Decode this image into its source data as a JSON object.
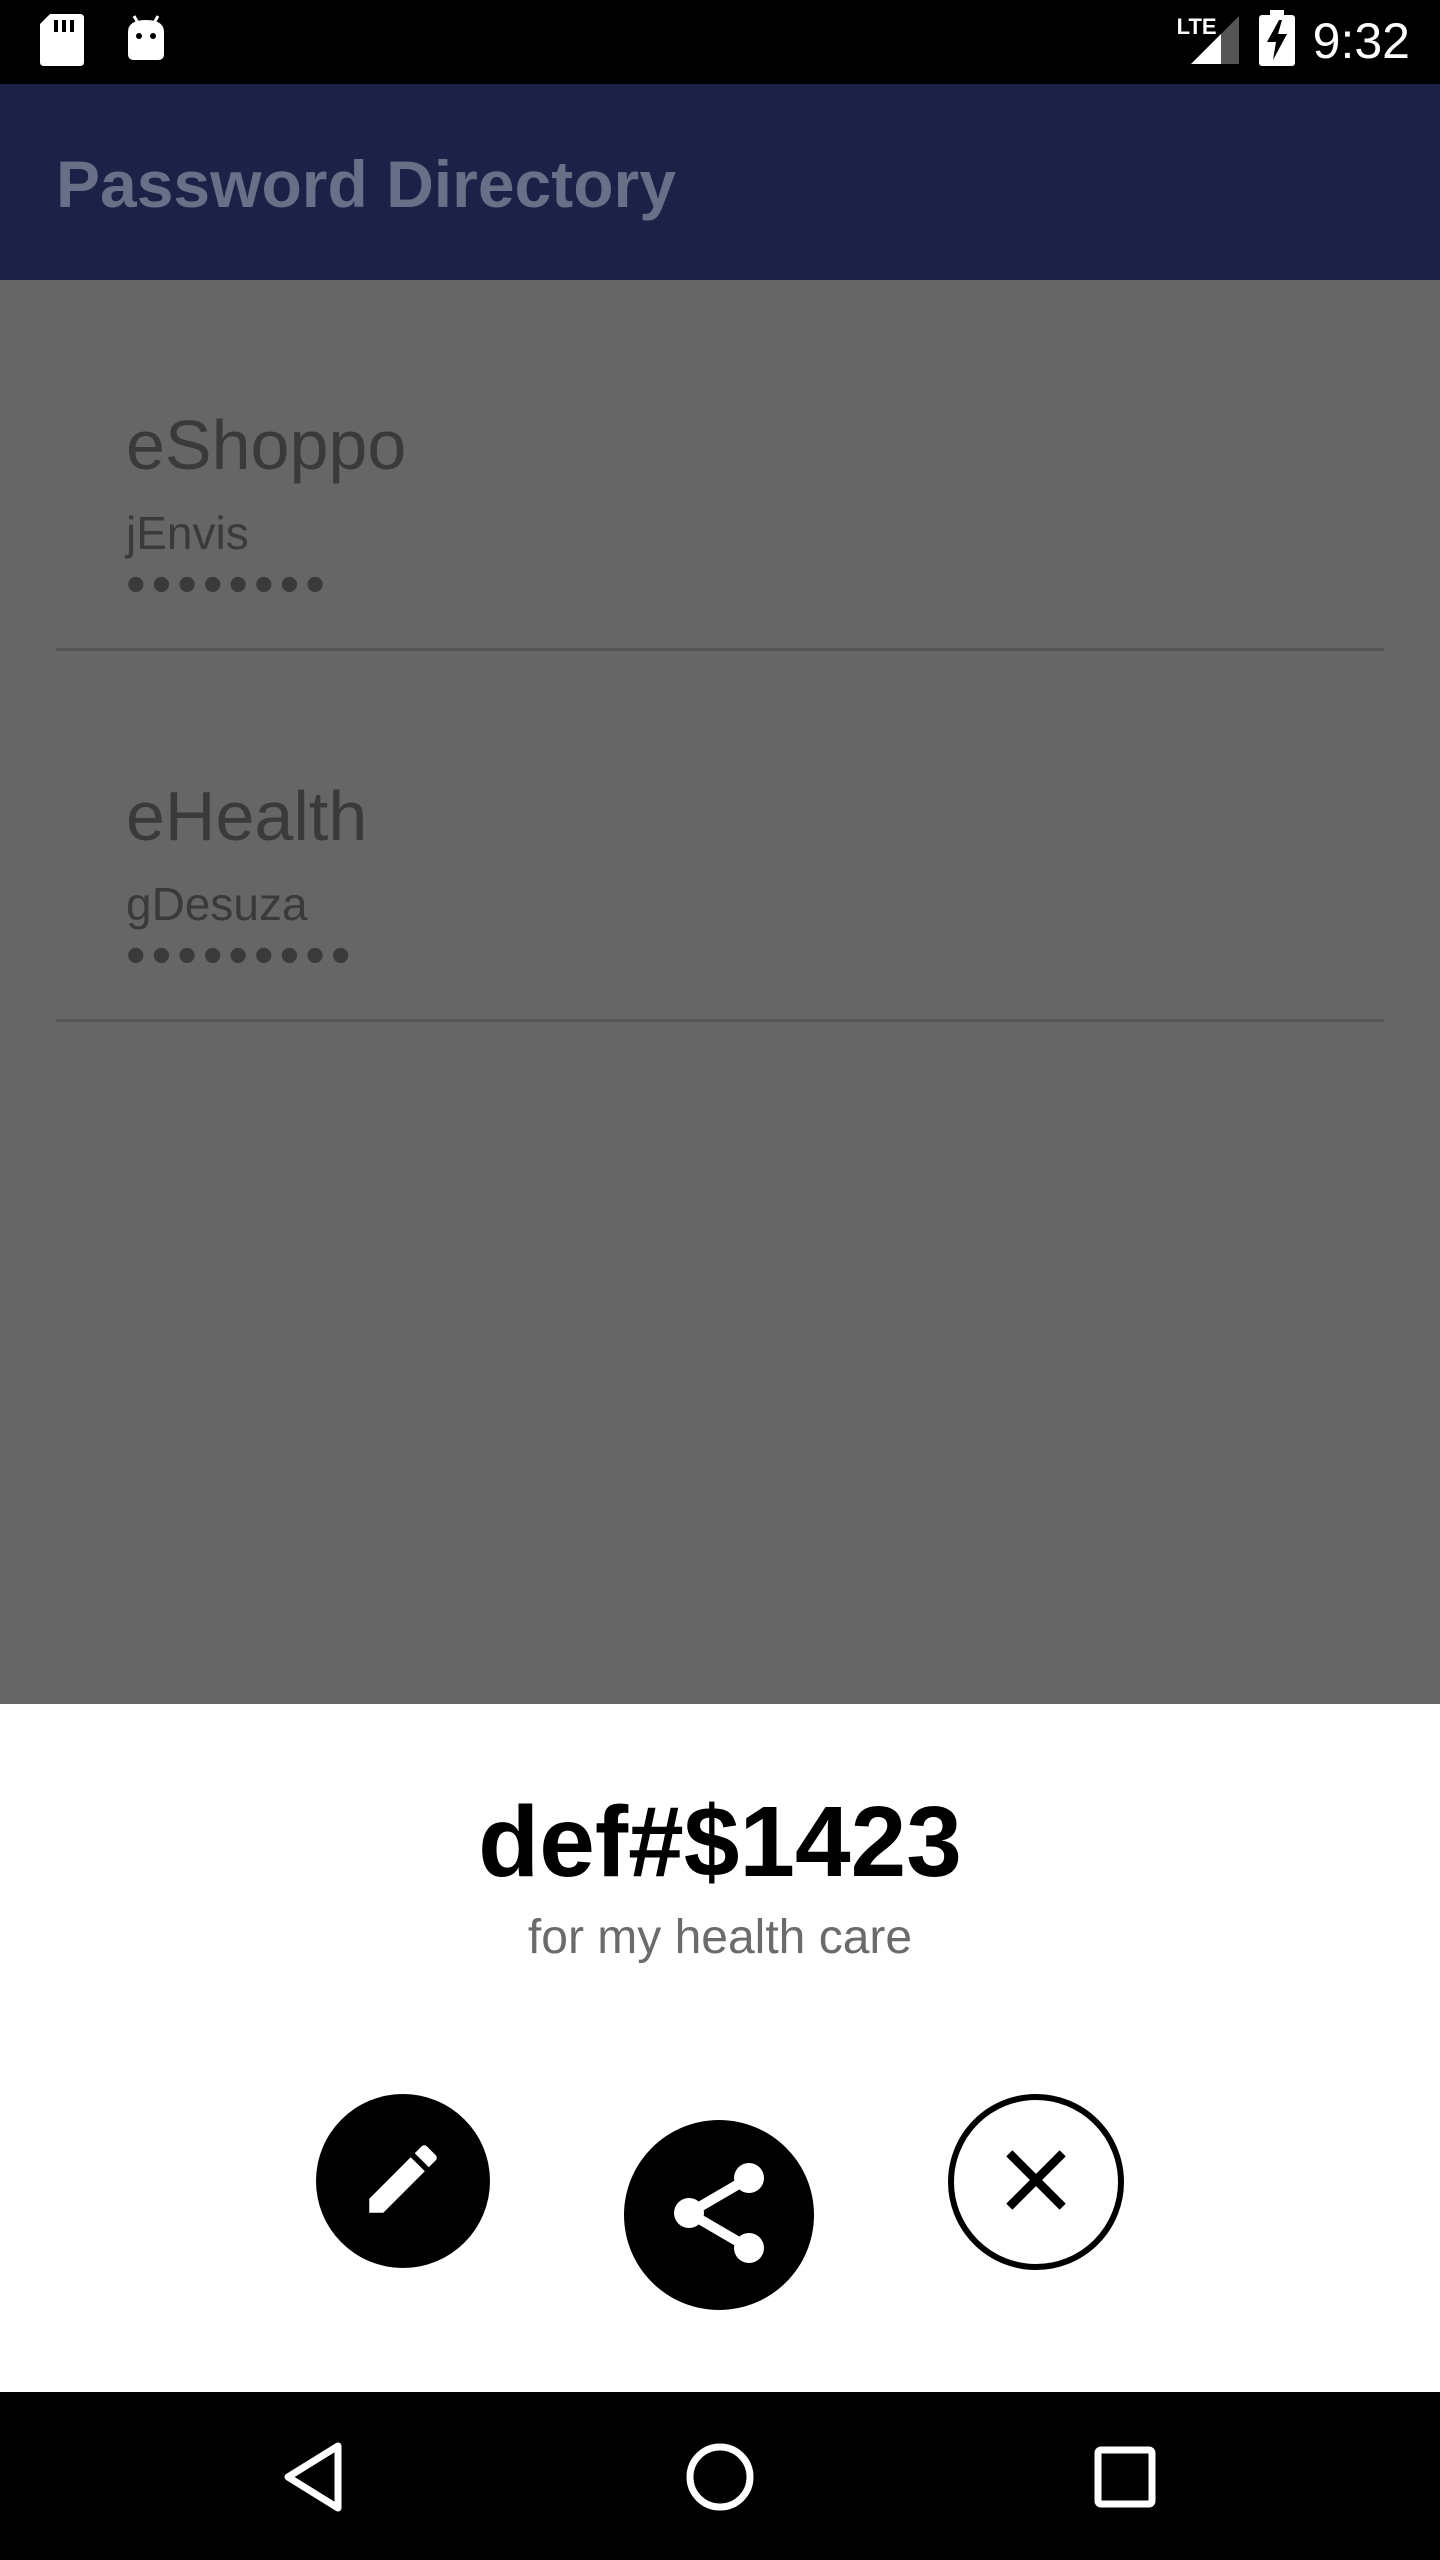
{
  "status_bar": {
    "time": "9:32",
    "network_label": "LTE",
    "icons": [
      "sd-card-icon",
      "android-icon",
      "signal-icon",
      "battery-charging-icon"
    ]
  },
  "app_bar": {
    "title": "Password Directory"
  },
  "entries": [
    {
      "title": "eShoppo",
      "username": "jEnvis",
      "password_mask": "••••••••"
    },
    {
      "title": "eHealth",
      "username": "gDesuza",
      "password_mask": "•••••••••"
    }
  ],
  "sheet": {
    "password": "def#$1423",
    "note": "for my health care",
    "actions": [
      "edit-icon",
      "share-icon",
      "close-icon"
    ]
  },
  "nav_bar": {
    "icons": [
      "back-icon",
      "home-icon",
      "recents-icon"
    ]
  },
  "colors": {
    "app_bar": "#1b2147",
    "scrim": "#666666",
    "sheet": "#ffffff",
    "accent_dark": "#000000"
  }
}
